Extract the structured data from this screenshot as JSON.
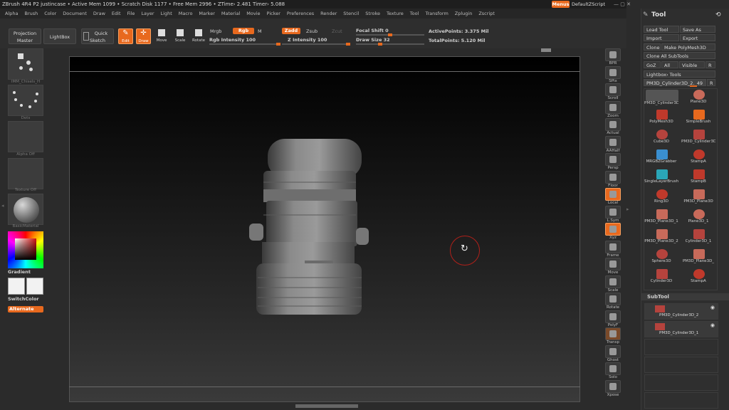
{
  "titlebar": {
    "text": "ZBrush 4R4 P2   justincase   • Active Mem 1099  • Scratch Disk 1177  • Free Mem 2996  • ZTime› 2.481  Timer› 5.088",
    "menus_label": "Menus",
    "script_label": "DefaultZScript"
  },
  "menubar": [
    "Alpha",
    "Brush",
    "Color",
    "Document",
    "Draw",
    "Edit",
    "File",
    "Layer",
    "Light",
    "Macro",
    "Marker",
    "Material",
    "Movie",
    "Picker",
    "Preferences",
    "Render",
    "Stencil",
    "Stroke",
    "Texture",
    "Tool",
    "Transform",
    "Zplugin",
    "Zscript"
  ],
  "shelf": {
    "projection_master": "Projection Master",
    "lightbox": "LightBox",
    "quick_sketch": "Quick Sketch",
    "edit": "Edit",
    "draw": "Draw",
    "move": "Move",
    "scale": "Scale",
    "rotate": "Rotate",
    "mrgb": "Mrgb",
    "rgb": "Rgb",
    "m": "M",
    "zadd": "Zadd",
    "zsub": "Zsub",
    "zcut": "Zcut",
    "rgb_intensity": "Rgb Intensity 100",
    "rgb_intensity_value": 100,
    "z_intensity": "Z Intensity 100",
    "z_intensity_value": 100,
    "focal_shift": "Focal Shift 0",
    "focal_shift_value": 0,
    "draw_size": "Draw Size 32",
    "draw_size_value": 32,
    "active_points": "ActivePoints: 3.375 Mil",
    "total_points": "TotalPoints: 5.120 Mil"
  },
  "lefttray": {
    "brush_label": "IMM_Chisels_H",
    "stroke_label": "Dots",
    "alpha_label": "Alpha Off",
    "texture_label": "Texture Off",
    "material_label": "BasicMaterial",
    "gradient_label": "Gradient",
    "switch_color_label": "SwitchColor",
    "alternate_label": "Alternate"
  },
  "rightshelf": [
    "BPR",
    "SPix",
    "Scroll",
    "Zoom",
    "Actual",
    "AAHalf",
    "Persp",
    "Floor",
    "Local",
    "L.Sym",
    "Xyz",
    "Frame",
    "Move",
    "Scale",
    "Rotate",
    "PolyF",
    "Transp",
    "Ghost",
    "Solo",
    "Xpose"
  ],
  "toolpal": {
    "title": "Tool",
    "load_tool": "Load Tool",
    "save_as": "Save As",
    "import": "Import",
    "export": "Export",
    "clone": "Clone",
    "make_polymesh": "Make PolyMesh3D",
    "clone_all": "Clone All SubTools",
    "goz": "GoZ",
    "all": "All",
    "visible": "Visible",
    "r": "R",
    "lightbox_tools": "Lightbox› Tools",
    "current_tool": "PM3D_Cylinder3D_2.",
    "current_tool_num": "49",
    "tools": [
      {
        "name": "PM3D_Cylinder3D",
        "color": "#b5433d"
      },
      {
        "name": "Plane3D",
        "color": "#c86a5a"
      },
      {
        "name": "PolyMesh3D",
        "color": "#c0392b"
      },
      {
        "name": "SimpleBrush",
        "color": "#e8691e"
      },
      {
        "name": "Cube3D",
        "color": "#b5433d"
      },
      {
        "name": "PM3D_Cylinder3D",
        "color": "#b5433d"
      },
      {
        "name": "MRGBZGrabber",
        "color": "#3a8fd0"
      },
      {
        "name": "StampA",
        "color": "#c0392b"
      },
      {
        "name": "SingleLayerBrush",
        "color": "#2aa6b8"
      },
      {
        "name": "StampB",
        "color": "#c0392b"
      },
      {
        "name": "Ring3D",
        "color": "#c0392b"
      },
      {
        "name": "PM3D_Plane3D",
        "color": "#c86a5a"
      },
      {
        "name": "PM3D_Plane3D_1",
        "color": "#c86a5a"
      },
      {
        "name": "Plane3D_1",
        "color": "#c86a5a"
      },
      {
        "name": "PM3D_Plane3D_2",
        "color": "#c86a5a"
      },
      {
        "name": "Cylinder3D_1",
        "color": "#b5433d"
      },
      {
        "name": "Sphere3D",
        "color": "#b5433d"
      },
      {
        "name": "PM3D_Plane3D_",
        "color": "#c86a5a"
      },
      {
        "name": "Cylinder3D",
        "color": "#b5433d"
      },
      {
        "name": "StampA",
        "color": "#c0392b"
      }
    ],
    "subtool_title": "SubTool",
    "subtools": [
      "PM3D_Cylinder3D_2",
      "PM3D_Cylinder3D_1"
    ]
  }
}
